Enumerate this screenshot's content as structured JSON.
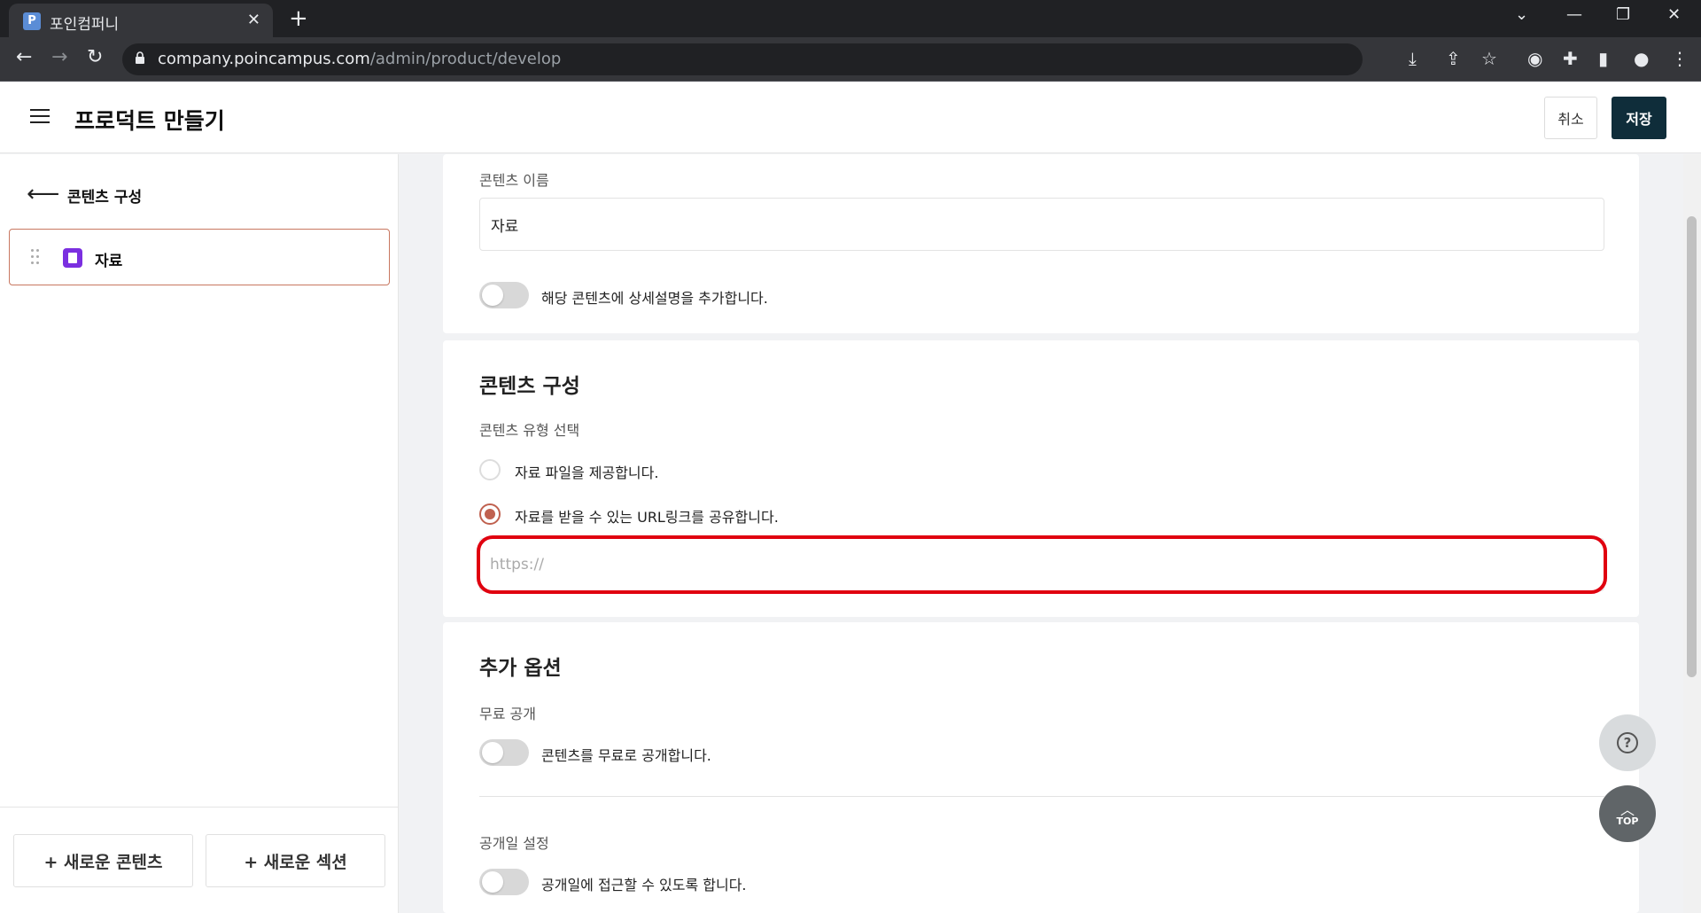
{
  "browser": {
    "tab_title": "포인컴퍼니",
    "tab_favicon": "P",
    "url_domain": "company.poincampus.com",
    "url_path": "/admin/product/develop"
  },
  "header": {
    "title": "프로덕트 만들기",
    "cancel_label": "취소",
    "save_label": "저장"
  },
  "sidebar": {
    "back_label": "콘텐츠 구성",
    "items": [
      {
        "label": "자료",
        "icon": "document-icon",
        "icon_color": "#7b2fe0"
      }
    ],
    "footer": {
      "new_content_label": "+ 새로운 콘텐츠",
      "new_section_label": "+ 새로운 섹션"
    }
  },
  "main": {
    "basic": {
      "name_label": "콘텐츠 이름",
      "name_value": "자료",
      "description_toggle_label": "해당 콘텐츠에 상세설명을 추가합니다.",
      "description_toggle_on": false
    },
    "composition": {
      "title": "콘텐츠 구성",
      "type_label": "콘텐츠 유형 선택",
      "options": [
        {
          "label": "자료 파일을 제공합니다.",
          "selected": false
        },
        {
          "label": "자료를 받을 수 있는 URL링크를 공유합니다.",
          "selected": true
        }
      ],
      "url_placeholder": "https://",
      "url_value": ""
    },
    "options_section": {
      "title": "추가 옵션",
      "free_label": "무료 공개",
      "free_toggle_label": "콘텐츠를 무료로 공개합니다.",
      "free_toggle_on": false,
      "open_date_label": "공개일 설정",
      "open_date_toggle_label": "공개일에 접근할 수 있도록 합니다.",
      "open_date_toggle_on": false
    }
  },
  "floating": {
    "help_symbol": "?",
    "top_label": "TOP"
  },
  "colors": {
    "accent": "#c0614f",
    "save_button": "#0f2d3a",
    "highlight": "#e0000f"
  }
}
